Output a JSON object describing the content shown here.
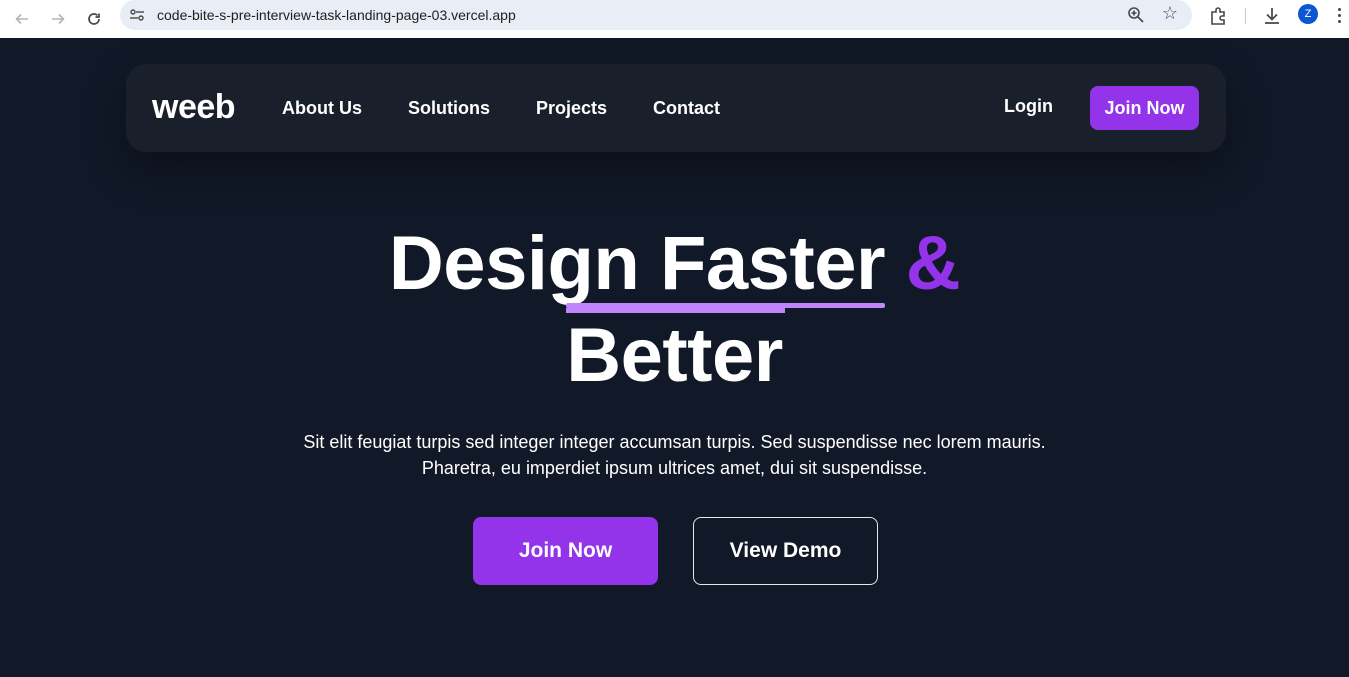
{
  "browser": {
    "url": "code-bite-s-pre-interview-task-landing-page-03.vercel.app",
    "profile_initial": "Z",
    "icons": [
      "back-arrow-icon",
      "forward-arrow-icon",
      "reload-icon",
      "site-info-icon",
      "zoom-icon",
      "star-icon",
      "extensions-icon",
      "download-icon",
      "kebab-menu-icon"
    ]
  },
  "nav": {
    "logo": "weeb",
    "links": [
      "About Us",
      "Solutions",
      "Projects",
      "Contact"
    ],
    "login": "Login",
    "join": "Join Now"
  },
  "hero": {
    "word_design": "Design",
    "word_faster": "Faster",
    "word_amp": "&",
    "word_better": "Better",
    "subtitle_line1": "Sit elit feugiat turpis sed integer integer accumsan turpis. Sed suspendisse nec lorem mauris.",
    "subtitle_line2": "Pharetra, eu imperdiet ipsum ultrices amet, dui sit suspendisse.",
    "primary_cta": "Join Now",
    "secondary_cta": "View Demo"
  },
  "colors": {
    "background": "#111827",
    "navbar": "#1a1f2c",
    "accent": "#9333ea",
    "underline": "#c084fc",
    "text": "#ffffff"
  }
}
